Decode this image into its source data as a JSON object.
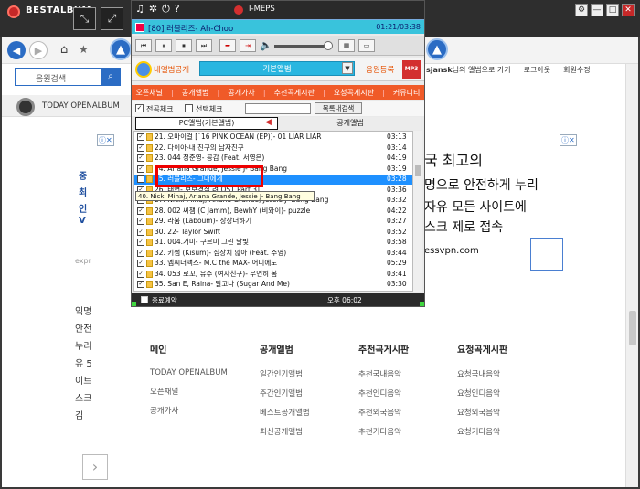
{
  "app": {
    "name": "BESTALBUM",
    "expand_icon": "expand-arrows-icon",
    "fullscreen_icon": "fullscreen-arrows-icon",
    "window_controls": [
      "⚙",
      "—",
      "□",
      "✕"
    ]
  },
  "site": {
    "search_label": "음원검색",
    "top_links": {
      "greeting_user": "sjansk",
      "greeting_suffix": "님의 앨범으로 가기",
      "logout": "로그아웃",
      "account": "회원수정"
    },
    "album_strip": "TODAY OPENALBUM",
    "ad_close": "ⓘ✕",
    "left_ad_lines": [
      "중",
      "최",
      "인",
      "V"
    ],
    "left_ad_expr": "expr",
    "left_korean": [
      "익명",
      "안전",
      "누리",
      "유 5",
      "이트",
      "스크",
      "김"
    ],
    "left_arrow": "›",
    "big_ad_lines": [
      "국 최고의",
      "명으로 안전하게 누리",
      "자유 모든 사이트에",
      "스크 제로 접속"
    ],
    "ad_url": "essvpn.com",
    "footer": [
      {
        "head": "메인",
        "items": [
          "TODAY OPENALBUM",
          "오픈채널",
          "공개가사"
        ]
      },
      {
        "head": "공개앨범",
        "items": [
          "일간인기앨범",
          "주간인기앨범",
          "베스트공개앨범",
          "최신공개앨범"
        ]
      },
      {
        "head": "추천곡게시판",
        "items": [
          "추천국내음악",
          "추천인디음악",
          "추천외국음악",
          "추천기타음악"
        ]
      },
      {
        "head": "요청곡게시판",
        "items": [
          "요청국내음악",
          "요청인디음악",
          "요청외국음악",
          "요청기타음악"
        ]
      }
    ]
  },
  "player": {
    "title": "I-MEPS",
    "now_playing": "[80] 러블리즈- Ah-Choo",
    "time": "01:21/03:38",
    "controls": [
      "⏮",
      "⏸",
      "⏹",
      "⏭",
      "➡",
      "⇥"
    ],
    "tab_myalbum": "내앨범공개",
    "tab_select": "기본앨범",
    "tab_register": "음원등록",
    "tab_mp3": "MP3",
    "menu": [
      "오픈채널",
      "공개앨범",
      "공개가사",
      "추천곡게시판",
      "요청곡게시판",
      "커뮤니티"
    ],
    "check_all": "전곡체크",
    "check_selected": "선택체크",
    "search_button": "목록내검색",
    "list_tab_pc": "PC앨범(기본앨범)",
    "list_tab_public": "공개앨범",
    "tracks": [
      {
        "title": "21.  오마이걸 [`16 PINK OCEAN (EP)]- 01 LIAR LIAR",
        "time": "03:13"
      },
      {
        "title": "22.  다이아-내 친구의 남자친구",
        "time": "03:14"
      },
      {
        "title": "23.  044 정준영- 공감 (Feat. 서영은)",
        "time": "04:19"
      },
      {
        "title": "24.  Ariana Grande, Jessie J- Bang Bang",
        "time": "03:19"
      },
      {
        "title": "25.  러블리즈- 그대에게",
        "time": "03:28"
      },
      {
        "title": "26.  태연- 보보경심 려 OST Part 3]...",
        "time": "03:36"
      },
      {
        "title": "27.  Nicki Minaj, Ariana Grande, Jessie J- Bang Bang",
        "time": "03:32"
      },
      {
        "title": "28.  002 씨잼 (C Jamm), BewhY (비와이)- puzzle",
        "time": "04:22"
      },
      {
        "title": "29.  라붐 (Laboum)- 상상더하기",
        "time": "03:27"
      },
      {
        "title": "30.  22- Taylor Swift",
        "time": "03:52"
      },
      {
        "title": "31.  004.거미- 구르미 그린 달빛",
        "time": "03:58"
      },
      {
        "title": "32.  키썸 (Kisum)- 심상치 않아 (Feat. 주영)",
        "time": "03:44"
      },
      {
        "title": "33.  엠씨더맥스- M.C the MAX- 어디에도",
        "time": "05:29"
      },
      {
        "title": "34.  053 로꼬, 유주 (여자친구)- 우연히 봄",
        "time": "03:41"
      },
      {
        "title": "35.  San E, Raina- 달고나 (Sugar And Me)",
        "time": "03:30"
      }
    ],
    "tooltip": "40. Nicki Minaj, Ariana Grande, Jessie J- Bang Bang",
    "status_label": "종료예약",
    "clock": "오후   06:02"
  }
}
